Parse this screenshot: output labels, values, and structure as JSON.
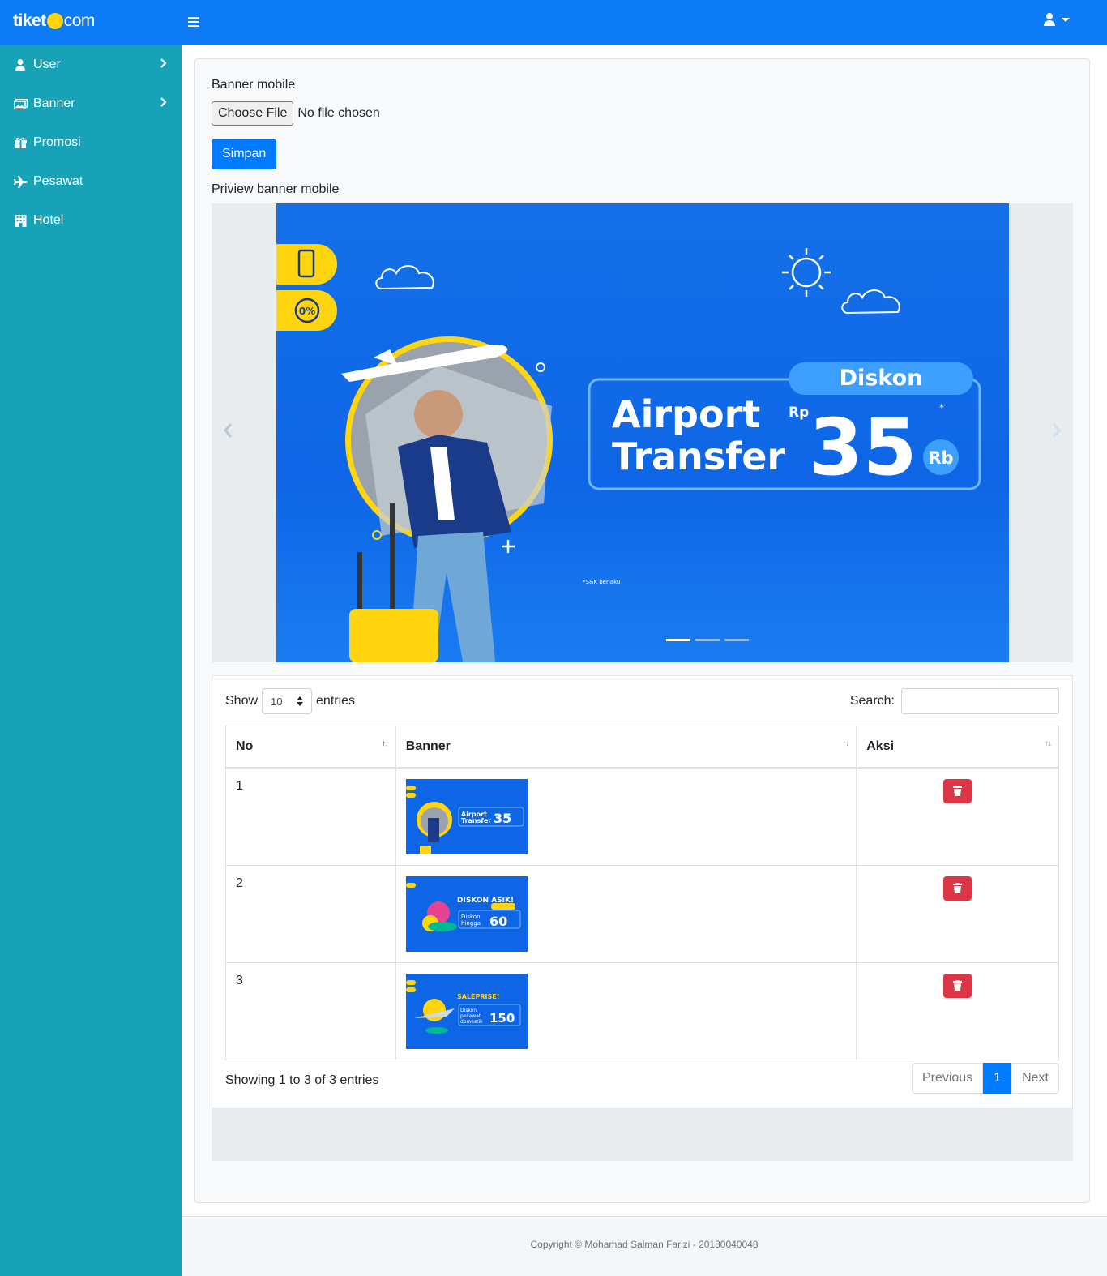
{
  "brand": {
    "name": "tiket",
    "tld": "com",
    "accent": "#ffd50f"
  },
  "navbar": {
    "color": "#0d7bf5",
    "menu_icon": "bars-icon",
    "user_icon": "user-icon"
  },
  "sidebar": {
    "color": "#17a2b8",
    "items": [
      {
        "label": "User",
        "icon": "user-icon",
        "has_submenu": true
      },
      {
        "label": "Banner",
        "icon": "images-icon",
        "has_submenu": true
      },
      {
        "label": "Promosi",
        "icon": "gift-icon",
        "has_submenu": false
      },
      {
        "label": "Pesawat",
        "icon": "plane-icon",
        "has_submenu": false
      },
      {
        "label": "Hotel",
        "icon": "hotel-icon",
        "has_submenu": false
      }
    ]
  },
  "form": {
    "label": "Banner mobile",
    "file_button": "Choose File",
    "file_status": "No file chosen",
    "submit_label": "Simpan",
    "preview_label": "Priview banner mobile"
  },
  "banner": {
    "headline_1": "Airport",
    "headline_2": "Transfer",
    "badge": "Diskon",
    "currency": "Rp",
    "amount": "35",
    "unit": "Rb",
    "terms": "*S&K berlaku",
    "slides_count": 3,
    "active_slide": 1
  },
  "table": {
    "show_label": "Show",
    "entries_label": "entries",
    "page_size": "10",
    "search_label": "Search:",
    "search_value": "",
    "columns": [
      "No",
      "Banner",
      "Aksi"
    ],
    "rows": [
      {
        "no": "1",
        "banner": "Airport Transfer Diskon 35"
      },
      {
        "no": "2",
        "banner": "DISKON ASIK! to do Diskon hingga 60%"
      },
      {
        "no": "3",
        "banner": "SALEPRISE! balik lagi! Diskon pesawat domestik 150"
      }
    ],
    "info": "Showing 1 to 3 of 3 entries",
    "prev_label": "Previous",
    "page": "1",
    "next_label": "Next"
  },
  "footer": {
    "text": "Copyright © Mohamad Salman Farizi - 20180040048"
  }
}
